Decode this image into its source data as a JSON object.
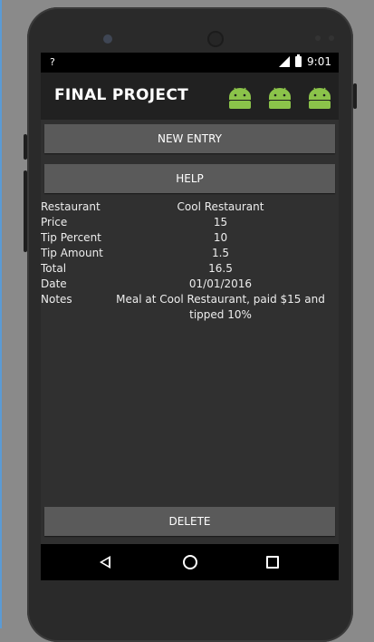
{
  "status_bar": {
    "left_glyph": "?",
    "time": "9:01"
  },
  "app": {
    "title": "FINAL PROJECT",
    "action_icons": [
      "android-icon",
      "android-icon",
      "android-icon"
    ],
    "accent_color": "#8bc34a"
  },
  "buttons": {
    "new_entry": "NEW ENTRY",
    "help": "HELP",
    "delete": "DELETE"
  },
  "entry": {
    "fields": [
      {
        "label": "Restaurant",
        "value": "Cool Restaurant"
      },
      {
        "label": "Price",
        "value": "15"
      },
      {
        "label": "Tip Percent",
        "value": "10"
      },
      {
        "label": "Tip Amount",
        "value": "1.5"
      },
      {
        "label": "Total",
        "value": "16.5"
      },
      {
        "label": "Date",
        "value": "01/01/2016"
      },
      {
        "label": "Notes",
        "value": "Meal at Cool Restaurant, paid $15 and tipped 10%"
      }
    ]
  },
  "nav_bar": {
    "icons": [
      "back-icon",
      "home-icon",
      "recents-icon"
    ]
  }
}
